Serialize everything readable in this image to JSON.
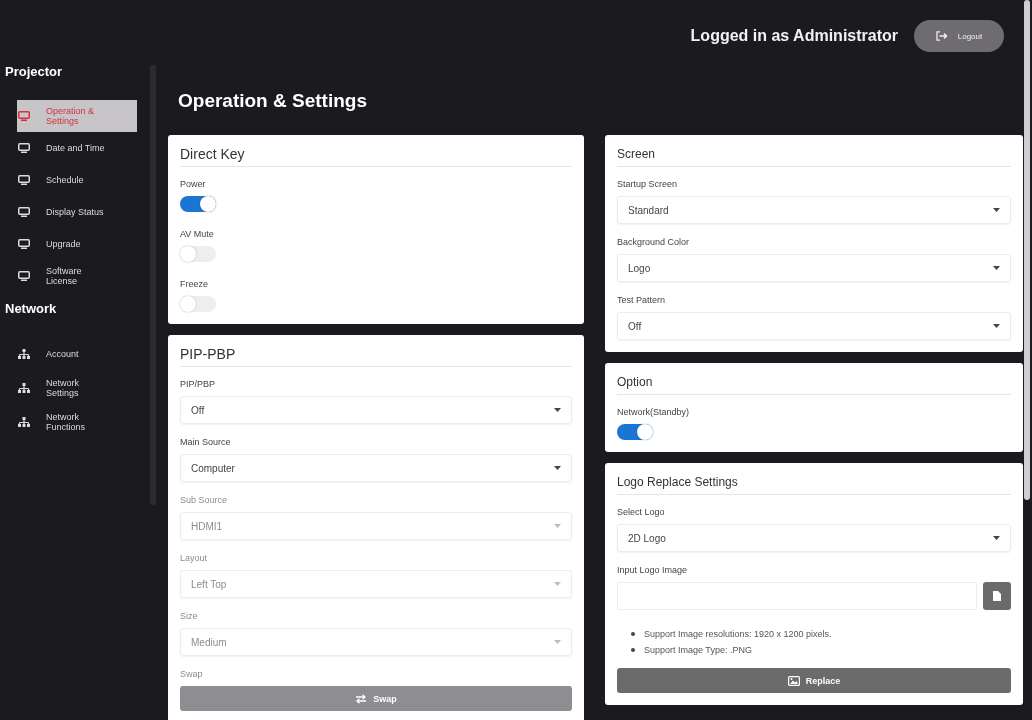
{
  "header": {
    "user": "Logged in as Administrator",
    "logout": "Logout"
  },
  "sidebar": {
    "sections": [
      {
        "title": "Projector",
        "kind": "projector",
        "items": [
          {
            "label": "Operation & Settings",
            "selected": true
          },
          {
            "label": "Date and Time",
            "selected": false
          },
          {
            "label": "Schedule",
            "selected": false
          },
          {
            "label": "Display Status",
            "selected": false
          },
          {
            "label": "Upgrade",
            "selected": false
          },
          {
            "label": "Software License",
            "selected": false
          }
        ]
      },
      {
        "title": "Network",
        "kind": "network",
        "items": [
          {
            "label": "Account",
            "selected": false
          },
          {
            "label": "Network Settings",
            "selected": false
          },
          {
            "label": "Network Functions",
            "selected": false
          }
        ]
      }
    ]
  },
  "page_title": "Operation & Settings",
  "columns": [
    [
      {
        "title": "Direct Key",
        "controls": [
          {
            "kind": "toggle",
            "label": "Power",
            "on": true
          },
          {
            "kind": "toggle",
            "label": "AV Mute",
            "on": false
          },
          {
            "kind": "toggle",
            "label": "Freeze",
            "on": false
          }
        ]
      },
      {
        "title": "PIP-PBP",
        "controls": [
          {
            "kind": "select",
            "label": "PIP/PBP",
            "value": "Off",
            "disabled": false
          },
          {
            "kind": "select",
            "label": "Main Source",
            "value": "Computer",
            "disabled": false
          },
          {
            "kind": "select",
            "label": "Sub Source",
            "value": "HDMI1",
            "disabled": true
          },
          {
            "kind": "select",
            "label": "Layout",
            "value": "Left Top",
            "disabled": true
          },
          {
            "kind": "select",
            "label": "Size",
            "value": "Medium",
            "disabled": true
          },
          {
            "kind": "label",
            "text": "Swap",
            "disabled": true
          },
          {
            "kind": "button",
            "label": "Swap",
            "disabled": true
          }
        ]
      }
    ],
    [
      {
        "title": "Screen",
        "controls": [
          {
            "kind": "select",
            "label": "Startup Screen",
            "value": "Standard",
            "disabled": false
          },
          {
            "kind": "select",
            "label": "Background Color",
            "value": "Logo",
            "disabled": false
          },
          {
            "kind": "select",
            "label": "Test Pattern",
            "value": "Off",
            "disabled": false
          }
        ]
      },
      {
        "title": "Option",
        "controls": [
          {
            "kind": "toggle",
            "label": "Network(Standby)",
            "on": true
          }
        ]
      },
      {
        "title": "Logo Replace Settings",
        "controls": [
          {
            "kind": "select",
            "label": "Select Logo",
            "value": "2D Logo",
            "disabled": false
          },
          {
            "kind": "file",
            "label": "Input Logo Image"
          },
          {
            "kind": "notes",
            "items": [
              "Support Image resolutions: 1920 x 1200 pixels.",
              "Support Image Type: .PNG"
            ]
          },
          {
            "kind": "button",
            "label": "Replace",
            "disabled": false
          }
        ]
      }
    ]
  ]
}
